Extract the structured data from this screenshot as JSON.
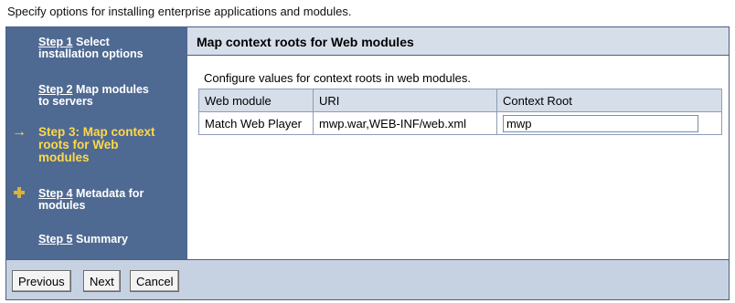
{
  "intro_text": "Specify options for installing enterprise applications and modules.",
  "steps": [
    {
      "link": "Step 1",
      "rest": " Select",
      "line2": "installation options"
    },
    {
      "link": "Step 2",
      "rest": " Map modules",
      "line2": "to servers"
    },
    {
      "current_line1": "Step 3: Map context",
      "current_line2": "roots for Web",
      "current_line3": "modules"
    },
    {
      "link": "Step 4",
      "rest": " Metadata for",
      "line2": "modules"
    },
    {
      "link": "Step 5",
      "rest": " Summary"
    }
  ],
  "content": {
    "title": "Map context roots for Web modules",
    "description": "Configure values for context roots in web modules.",
    "columns": [
      "Web module",
      "URI",
      "Context Root"
    ],
    "rows": [
      {
        "web_module": "Match Web Player",
        "uri": "mwp.war,WEB-INF/web.xml",
        "context_root": "mwp"
      }
    ]
  },
  "buttons": {
    "previous": "Previous",
    "next": "Next",
    "cancel": "Cancel"
  },
  "icons": {
    "current_step": "arrow-right-icon",
    "step4": "plus-icon"
  },
  "colors": {
    "sidebar_bg": "#4f6a92",
    "current_step_text": "#ffd84a",
    "header_bg": "#d6deea",
    "button_bar_bg": "#c6d2e2"
  }
}
